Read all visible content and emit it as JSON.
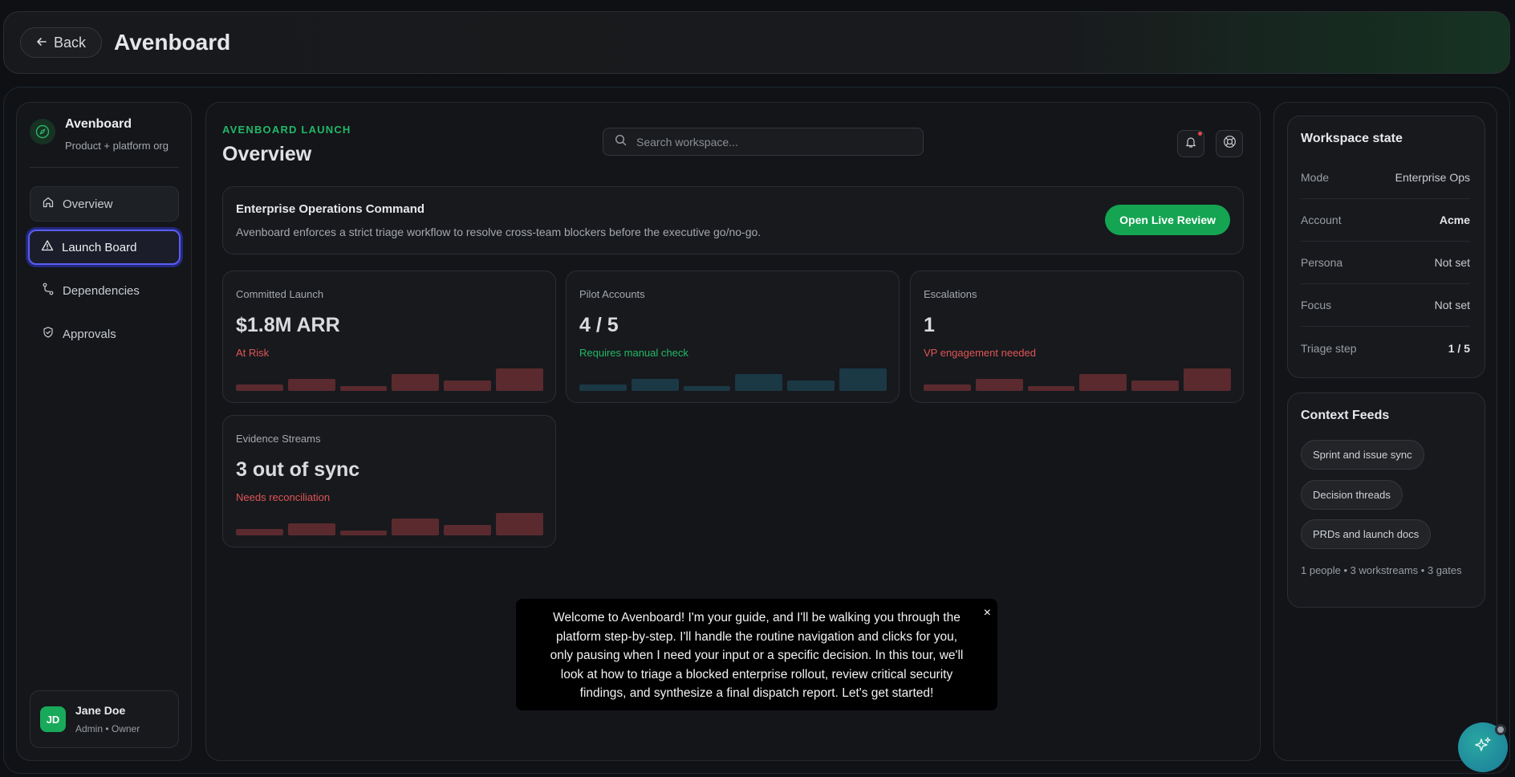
{
  "topbar": {
    "back_label": "Back",
    "page_title": "Avenboard"
  },
  "sidebar": {
    "brand_name": "Avenboard",
    "brand_sub": "Product + platform org",
    "items": [
      {
        "label": "Overview",
        "icon": "home-icon"
      },
      {
        "label": "Launch Board",
        "icon": "warning-triangle-icon"
      },
      {
        "label": "Dependencies",
        "icon": "route-icon"
      },
      {
        "label": "Approvals",
        "icon": "shield-check-icon"
      }
    ],
    "user": {
      "initials": "JD",
      "name": "Jane Doe",
      "role": "Admin • Owner"
    }
  },
  "main": {
    "eyebrow": "AVENBOARD LAUNCH",
    "title": "Overview",
    "search_placeholder": "Search workspace...",
    "banner": {
      "title": "Enterprise Operations Command",
      "desc": "Avenboard enforces a strict triage workflow to resolve cross-team blockers before the executive go/no-go.",
      "button": "Open Live Review"
    },
    "cards": [
      {
        "label": "Committed Launch",
        "value": "$1.8M ARR",
        "status": "At Risk",
        "status_color": "#e05555",
        "bar_color": "#5a2a2e",
        "bars": [
          0.3,
          0.55,
          0.2,
          0.75,
          0.45,
          1.0
        ]
      },
      {
        "label": "Pilot Accounts",
        "value": "4 / 5",
        "status": "Requires manual check",
        "status_color": "#22b866",
        "bar_color": "#1b3845",
        "bars": [
          0.3,
          0.55,
          0.2,
          0.75,
          0.45,
          1.0
        ]
      },
      {
        "label": "Escalations",
        "value": "1",
        "status": "VP engagement needed",
        "status_color": "#e05555",
        "bar_color": "#5a2a2e",
        "bars": [
          0.3,
          0.55,
          0.2,
          0.75,
          0.45,
          1.0
        ]
      },
      {
        "label": "Evidence Streams",
        "value": "3 out of sync",
        "status": "Needs reconciliation",
        "status_color": "#e05555",
        "bar_color": "#5a2a2e",
        "bars": [
          0.3,
          0.55,
          0.2,
          0.75,
          0.45,
          1.0
        ]
      }
    ]
  },
  "workspace": {
    "title": "Workspace state",
    "rows": [
      {
        "key": "Mode",
        "value": "Enterprise Ops"
      },
      {
        "key": "Account",
        "value": "Acme"
      },
      {
        "key": "Persona",
        "value": "Not set"
      },
      {
        "key": "Focus",
        "value": "Not set"
      },
      {
        "key": "Triage step",
        "value": "1 / 5"
      }
    ]
  },
  "context_feeds": {
    "title": "Context Feeds",
    "chips": [
      "Sprint and issue sync",
      "Decision threads",
      "PRDs and launch docs"
    ],
    "meta": "1 people • 3 workstreams • 3 gates"
  },
  "guide": {
    "text": "Welcome to Avenboard! I'm your guide, and I'll be walking you through the platform step-by-step. I'll handle the routine navigation and clicks for you, only pausing when I need your input or a specific decision. In this tour, we'll look at how to triage a blocked enterprise rollout, review critical security findings, and synthesize a final dispatch report. Let's get started!",
    "close": "×"
  },
  "colors": {
    "accent_green": "#14a452",
    "active_nav_border": "#5a5ef0",
    "danger": "#e05555"
  }
}
